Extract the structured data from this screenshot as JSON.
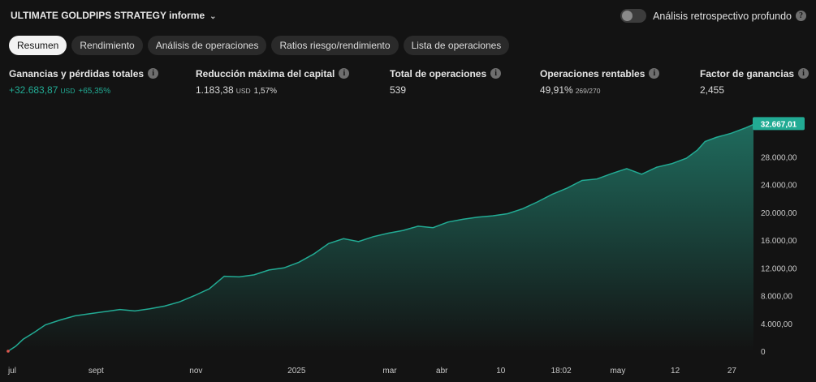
{
  "header": {
    "title": "ULTIMATE GOLDPIPS STRATEGY informe",
    "toggle_label": "Análisis retrospectivo profundo",
    "toggle_on": false
  },
  "tabs": [
    {
      "label": "Resumen",
      "active": true
    },
    {
      "label": "Rendimiento",
      "active": false
    },
    {
      "label": "Análisis de operaciones",
      "active": false
    },
    {
      "label": "Ratios riesgo/rendimiento",
      "active": false
    },
    {
      "label": "Lista de operaciones",
      "active": false
    }
  ],
  "metrics": {
    "net_profit": {
      "label": "Ganancias y pérdidas totales",
      "value": "+32.683,87",
      "unit": "USD",
      "extra": "+65,35%"
    },
    "drawdown": {
      "label": "Reducción máxima del capital",
      "value": "1.183,38",
      "unit": "USD",
      "extra": "1,57%"
    },
    "total_trades": {
      "label": "Total de operaciones",
      "value": "539"
    },
    "profitable": {
      "label": "Operaciones rentables",
      "value": "49,91%",
      "extra": "269/270"
    },
    "profit_factor": {
      "label": "Factor de ganancias",
      "value": "2,455"
    }
  },
  "colors": {
    "accent": "#22ab94",
    "area_top": "#1f6b5d",
    "area_bottom": "#131313",
    "background": "#131313"
  },
  "chart_data": {
    "type": "area",
    "title": "",
    "xlabel": "",
    "ylabel": "",
    "ylim": [
      0,
      34000
    ],
    "y_ticks": [
      0,
      4000,
      8000,
      12000,
      16000,
      20000,
      24000,
      28000
    ],
    "y_tick_labels": [
      "0",
      "4.000,00",
      "8.000,00",
      "12.000,00",
      "16.000,00",
      "20.000,00",
      "24.000,00",
      "28.000,00"
    ],
    "x_tick_labels": [
      "jul",
      "sept",
      "nov",
      "2025",
      "mar",
      "abr",
      "10",
      "18:02",
      "may",
      "12",
      "27"
    ],
    "x_tick_positions": [
      0.0,
      0.118,
      0.252,
      0.387,
      0.512,
      0.582,
      0.661,
      0.742,
      0.818,
      0.895,
      0.971
    ],
    "last_value_label": "32.667,01",
    "series": [
      {
        "x": [
          0,
          0.01,
          0.02,
          0.035,
          0.05,
          0.07,
          0.09,
          0.11,
          0.13,
          0.15,
          0.17,
          0.19,
          0.21,
          0.23,
          0.25,
          0.27,
          0.29,
          0.31,
          0.33,
          0.35,
          0.37,
          0.39,
          0.41,
          0.43,
          0.45,
          0.47,
          0.49,
          0.51,
          0.53,
          0.55,
          0.57,
          0.59,
          0.61,
          0.63,
          0.65,
          0.67,
          0.69,
          0.71,
          0.73,
          0.75,
          0.77,
          0.79,
          0.81,
          0.83,
          0.85,
          0.87,
          0.89,
          0.91,
          0.925,
          0.935,
          0.95,
          0.97,
          0.99,
          1.0
        ],
        "values": [
          0,
          700,
          1700,
          2700,
          3800,
          4500,
          5100,
          5400,
          5700,
          6000,
          5800,
          6100,
          6500,
          7100,
          8000,
          9000,
          10800,
          10700,
          11000,
          11700,
          12000,
          12800,
          14000,
          15500,
          16200,
          15800,
          16500,
          17000,
          17400,
          18000,
          17800,
          18600,
          19000,
          19300,
          19500,
          19800,
          20500,
          21500,
          22600,
          23500,
          24600,
          24800,
          25600,
          26300,
          25500,
          26500,
          27000,
          27800,
          29000,
          30200,
          30800,
          31400,
          32200,
          32667
        ]
      }
    ]
  }
}
